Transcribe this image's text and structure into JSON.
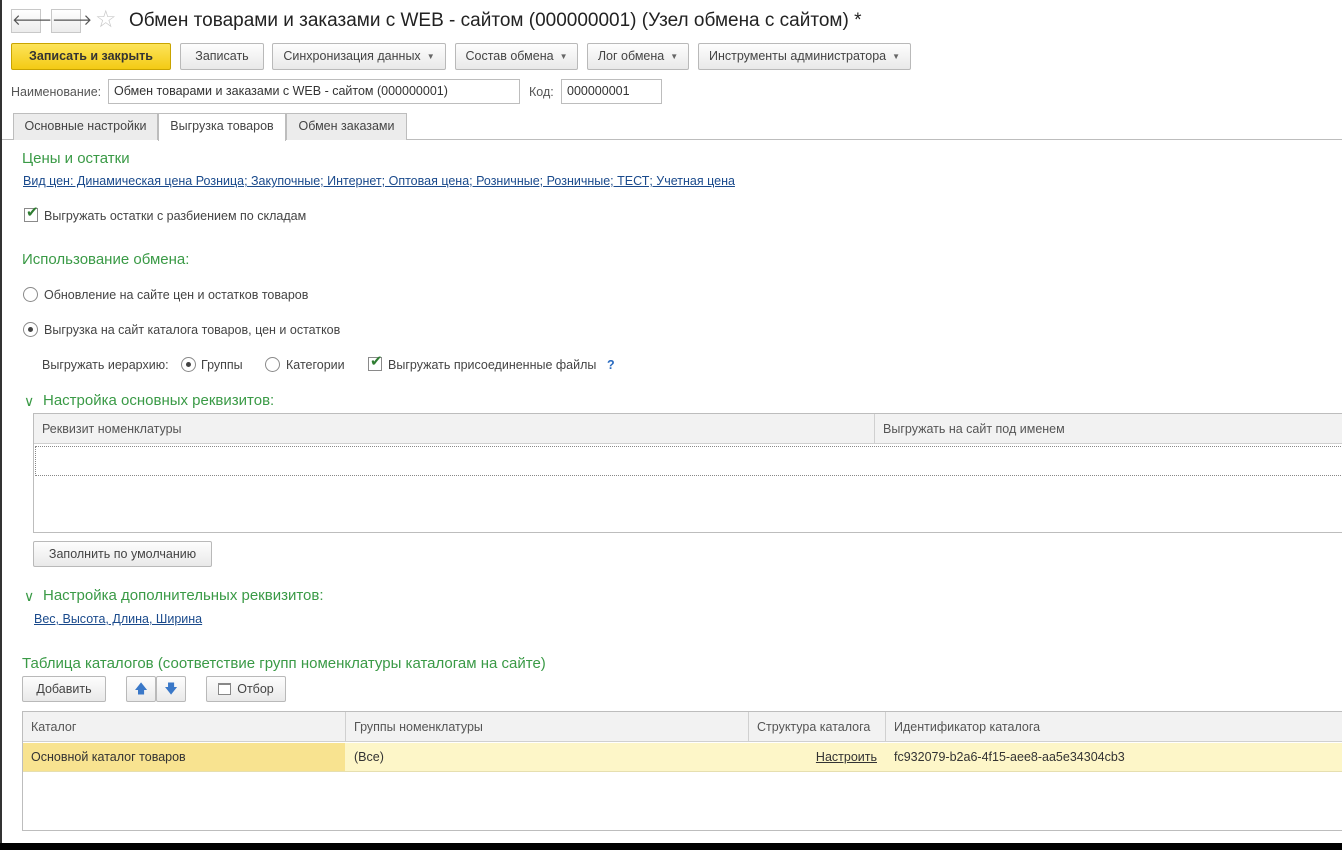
{
  "header": {
    "back_glyph": "🡐",
    "forward_glyph": "🡒",
    "star_glyph": "☆",
    "title": "Обмен товарами и заказами с WEB - сайтом (000000001) (Узел обмена с сайтом) *"
  },
  "toolbar": {
    "save_close": "Записать и закрыть",
    "save": "Записать",
    "sync": "Синхронизация данных",
    "composition": "Состав обмена",
    "log": "Лог обмена",
    "admin_tools": "Инструменты администратора",
    "caret_glyph": "▼"
  },
  "form": {
    "name_label": "Наименование:",
    "name_value": "Обмен товарами и заказами с WEB - сайтом (000000001)",
    "code_label": "Код:",
    "code_value": "000000001"
  },
  "tabs": [
    {
      "label": "Основные настройки"
    },
    {
      "label": "Выгрузка товаров"
    },
    {
      "label": "Обмен заказами"
    }
  ],
  "prices": {
    "title": "Цены и остатки",
    "price_types_link": "Вид цен: Динамическая цена Розница; Закупочные; Интернет; Оптовая цена; Розничные; Розничные; ТЕСТ; Учетная цена",
    "split_by_warehouse_label": "Выгружать остатки с разбиением по складам",
    "split_by_warehouse_checked": true
  },
  "usage": {
    "title": "Использование обмена:",
    "option_update": "Обновление на сайте цен и остатков товаров",
    "option_catalog": "Выгрузка на сайт каталога товаров, цен и остатков",
    "selected": "option_catalog",
    "hierarchy_label": "Выгружать иерархию:",
    "hierarchy_groups": "Группы",
    "hierarchy_categories": "Категории",
    "hierarchy_selected": "Группы",
    "attached_files_label": "Выгружать присоединенные файлы",
    "attached_files_checked": true,
    "help_glyph": "?"
  },
  "main_attrs": {
    "title": "Настройка основных реквизитов:",
    "chevron_glyph": "∨",
    "columns": [
      "Реквизит номенклатуры",
      "Выгружать на сайт под именем"
    ],
    "fill_default": "Заполнить по умолчанию"
  },
  "extra_attrs": {
    "title": "Настройка дополнительных реквизитов:",
    "chevron_glyph": "∨",
    "link": "Вес, Высота, Длина, Ширина"
  },
  "catalogs": {
    "title": "Таблица каталогов (соответствие групп номенклатуры каталогам на сайте)",
    "add": "Добавить",
    "up_glyph": "🡅",
    "down_glyph": "🡇",
    "filter": "Отбор",
    "columns": [
      "Каталог",
      "Группы номенклатуры",
      "Структура каталога",
      "Идентификатор каталога"
    ],
    "rows": [
      {
        "catalog": "Основной каталог товаров",
        "groups": "(Все)",
        "structure": "Настроить",
        "identifier": "fc932079-b2a6-4f15-aee8-aa5e34304cb3"
      }
    ]
  },
  "colors": {
    "accent_green": "#3a9a46",
    "link_blue": "#1a4a8c",
    "primary_button": "#f5d02a",
    "selected_row": "#fdf6c8"
  }
}
